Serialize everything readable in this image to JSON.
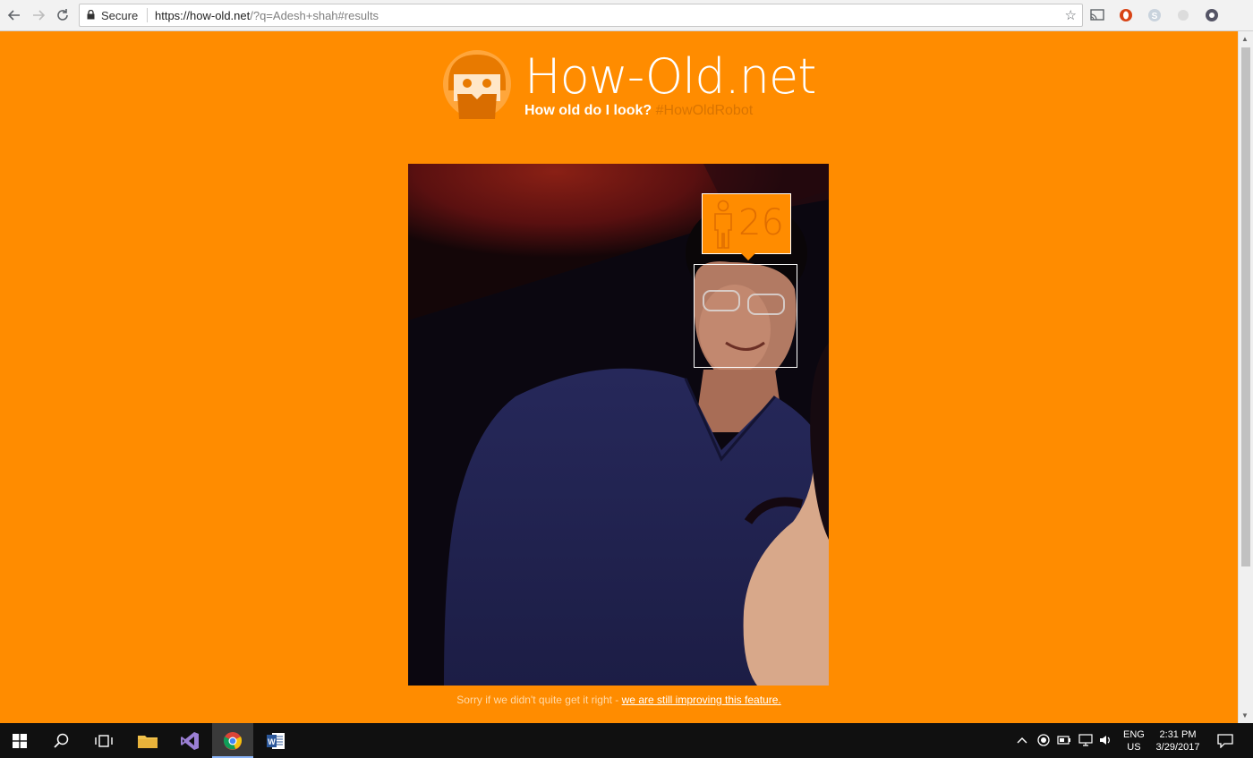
{
  "browser": {
    "secure_label": "Secure",
    "url_host": "https://how-old.net",
    "url_rest": "/?q=Adesh+shah#results"
  },
  "site": {
    "title": "How-Old.net",
    "tagline": "How old do I look?",
    "hashtag": "#HowOldRobot"
  },
  "result": {
    "age": "26",
    "gender_icon": "male-person-icon"
  },
  "footer": {
    "note": "Sorry if we didn't quite get it right - ",
    "link": "we are still improving this feature."
  },
  "taskbar": {
    "language": "ENG",
    "region": "US",
    "time": "2:31 PM",
    "date": "3/29/2017"
  },
  "colors": {
    "page_bg": "#ff8c00",
    "badge_text": "#e06e00",
    "hashtag": "#d97400"
  }
}
